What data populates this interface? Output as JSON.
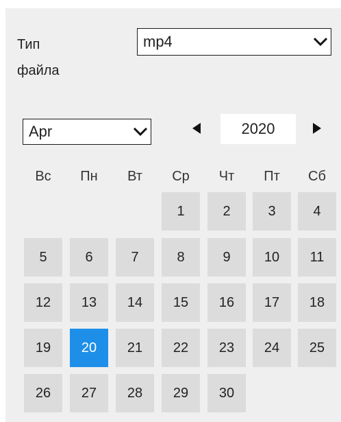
{
  "file_type": {
    "label": "Тип\nфайла",
    "label_line1": "Тип",
    "label_line2": "файла",
    "selected": "mp4"
  },
  "calendar": {
    "month": "Apr",
    "year": "2020",
    "weekdays": [
      "Вс",
      "Пн",
      "Вт",
      "Ср",
      "Чт",
      "Пт",
      "Сб"
    ],
    "days": [
      "1",
      "2",
      "3",
      "4",
      "5",
      "6",
      "7",
      "8",
      "9",
      "10",
      "11",
      "12",
      "13",
      "14",
      "15",
      "16",
      "17",
      "18",
      "19",
      "20",
      "21",
      "22",
      "23",
      "24",
      "25",
      "26",
      "27",
      "28",
      "29",
      "30"
    ],
    "first_weekday_index": 3,
    "selected_day": "20",
    "selected_color": "#1e8fe8",
    "day_bg_color": "#dcdcdc"
  },
  "icons": {
    "dropdown": "chevron-down-icon",
    "prev": "triangle-left-icon",
    "next": "triangle-right-icon"
  }
}
